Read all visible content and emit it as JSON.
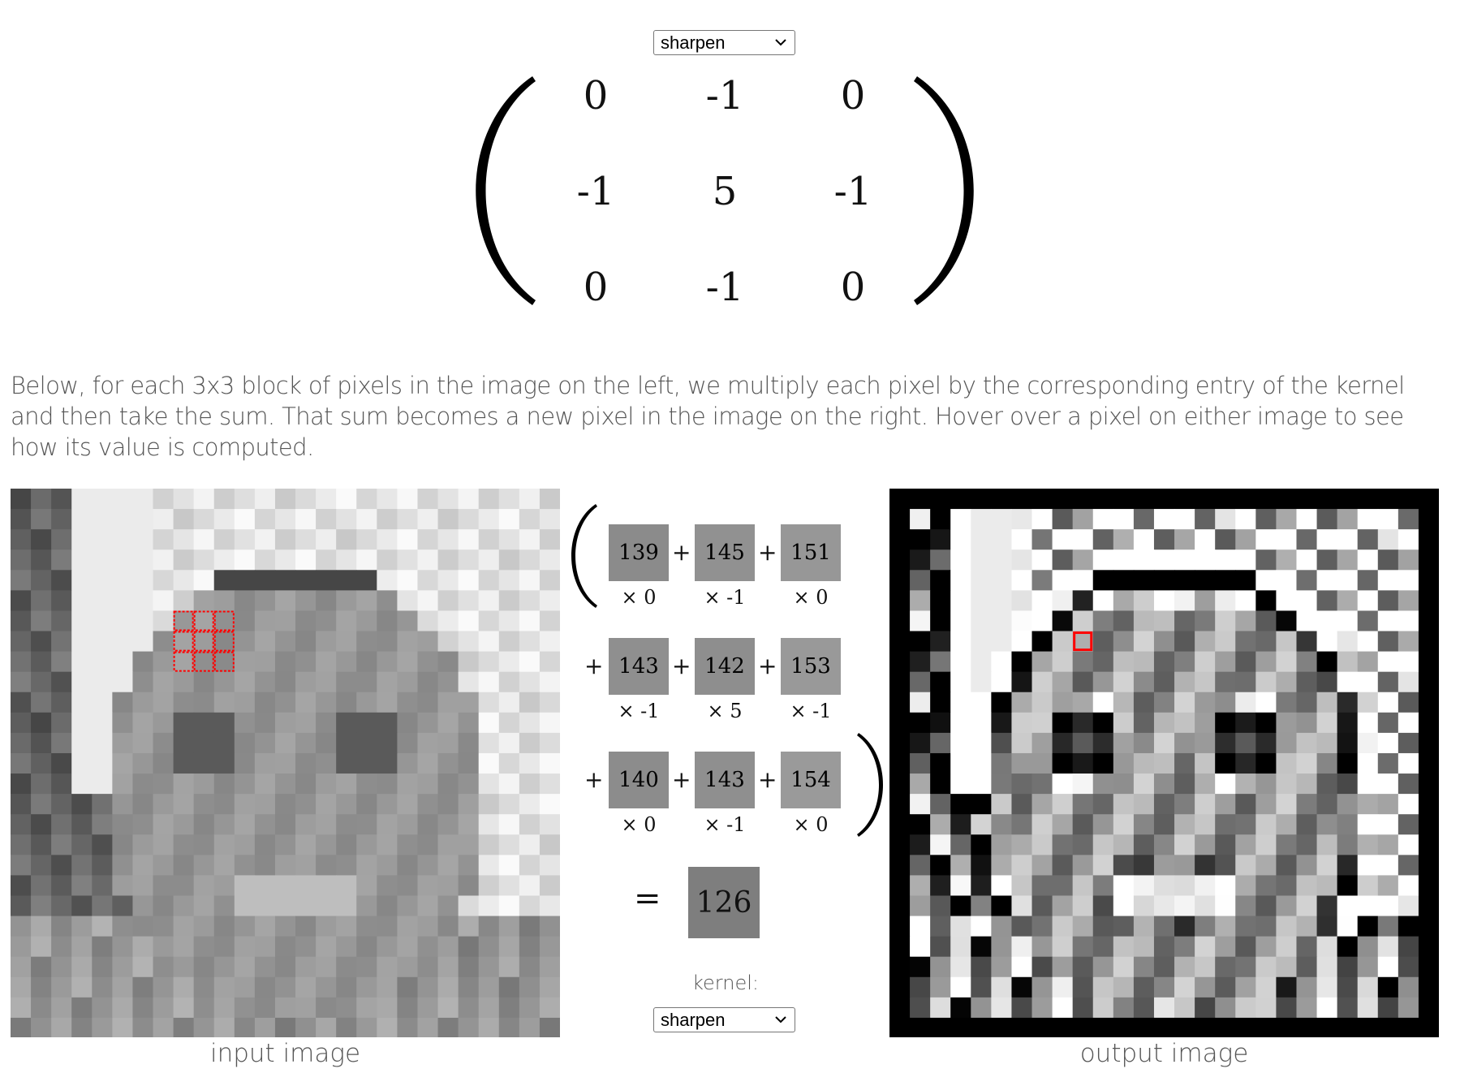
{
  "kernel_select": {
    "value": "sharpen"
  },
  "kernel_matrix": [
    [
      "0",
      "-1",
      "0"
    ],
    [
      "-1",
      "5",
      "-1"
    ],
    [
      "0",
      "-1",
      "0"
    ]
  ],
  "description": "Below, for each 3x3 block of pixels in the image on the left, we multiply each pixel by the corresponding entry of the kernel and then take the sum. That sum becomes a new pixel in the image on the right. Hover over a pixel on either image to see how its value is computed.",
  "calculation": {
    "pixels": [
      {
        "value": "139",
        "multiplier": "× 0",
        "color": "#8b8b8b"
      },
      {
        "value": "145",
        "multiplier": "× -1",
        "color": "#919191"
      },
      {
        "value": "151",
        "multiplier": "× 0",
        "color": "#979797"
      },
      {
        "value": "143",
        "multiplier": "× -1",
        "color": "#8f8f8f"
      },
      {
        "value": "142",
        "multiplier": "× 5",
        "color": "#8e8e8e"
      },
      {
        "value": "153",
        "multiplier": "× -1",
        "color": "#999999"
      },
      {
        "value": "140",
        "multiplier": "× 0",
        "color": "#8c8c8c"
      },
      {
        "value": "143",
        "multiplier": "× -1",
        "color": "#8f8f8f"
      },
      {
        "value": "154",
        "multiplier": "× 0",
        "color": "#9a9a9a"
      }
    ],
    "plus": "+",
    "equals": "=",
    "result": "126",
    "result_color": "#7e7e7e"
  },
  "kernel_label": "kernel:",
  "bottom_select": {
    "value": "sharpen"
  },
  "captions": {
    "input": "input image",
    "output": "output image"
  },
  "highlight_color": "#ff0000"
}
